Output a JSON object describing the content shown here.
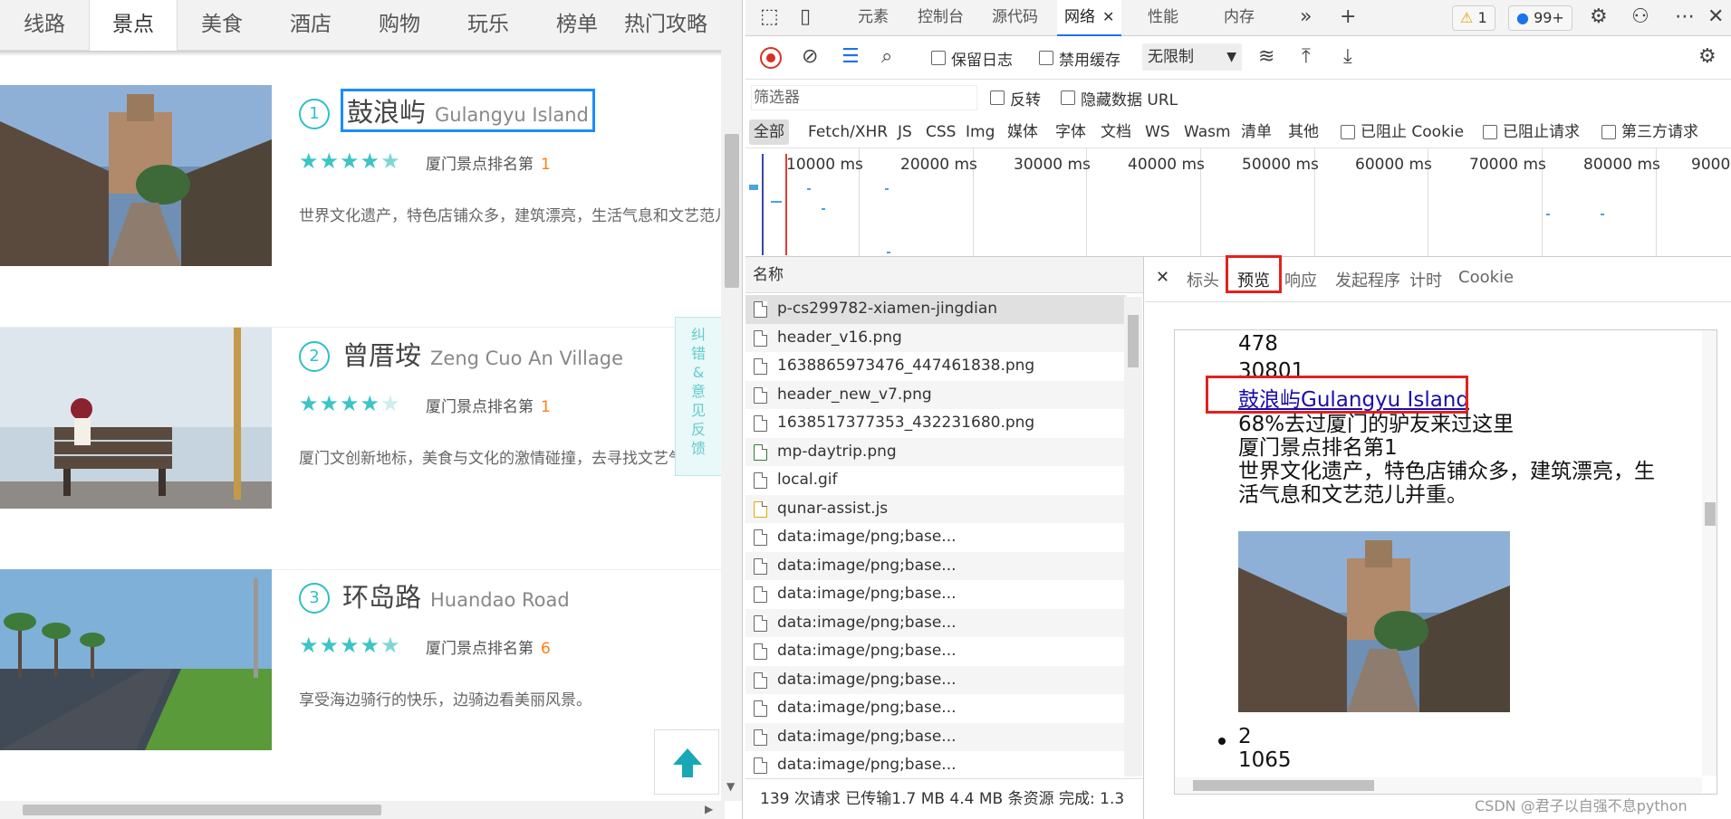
{
  "nav": {
    "items": [
      "线路",
      "景点",
      "美食",
      "酒店",
      "购物",
      "玩乐",
      "榜单",
      "热门攻略"
    ],
    "active_index": 1
  },
  "spots": [
    {
      "rank": "1",
      "name_cn": "鼓浪屿",
      "name_en": "Gulangyu Island",
      "stars": 4.5,
      "rank_text": "厦门景点排名第",
      "rank_num": "1",
      "desc": "世界文化遗产，特色店铺众多，建筑漂亮，生活气息和文艺范儿并重。"
    },
    {
      "rank": "2",
      "name_cn": "曾厝垵",
      "name_en": "Zeng Cuo An Village",
      "stars": 4,
      "rank_text": "厦门景点排名第",
      "rank_num": "1",
      "desc": "厦门文创新地标，美食与文化的激情碰撞，去寻找文艺气息吧。"
    },
    {
      "rank": "3",
      "name_cn": "环岛路",
      "name_en": "Huandao Road",
      "stars": 4.5,
      "rank_text": "厦门景点排名第",
      "rank_num": "6",
      "desc": "享受海边骑行的快乐，边骑边看美丽风景。"
    }
  ],
  "feedback_label": "纠错&意见反馈",
  "devtools": {
    "tabs": [
      "元素",
      "控制台",
      "源代码",
      "网络",
      "性能",
      "内存"
    ],
    "active_tab": "网络",
    "warning_count": "1",
    "message_count": "99+",
    "toolbar": {
      "preserve_log": "保留日志",
      "disable_cache": "禁用缓存",
      "throttle": "无限制"
    },
    "filter": {
      "placeholder": "筛选器",
      "invert": "反转",
      "hide_data_urls": "隐藏数据 URL"
    },
    "types": [
      "全部",
      "Fetch/XHR",
      "JS",
      "CSS",
      "Img",
      "媒体",
      "字体",
      "文档",
      "WS",
      "Wasm",
      "清单",
      "其他"
    ],
    "blocked": {
      "cookies": "已阻止 Cookie",
      "requests": "已阻止请求",
      "third_party": "第三方请求"
    },
    "timeline_ticks": [
      "10000 ms",
      "20000 ms",
      "30000 ms",
      "40000 ms",
      "50000 ms",
      "60000 ms",
      "70000 ms",
      "80000 ms",
      "9000"
    ],
    "name_header": "名称",
    "requests": [
      "p-cs299782-xiamen-jingdian",
      "header_v16.png",
      "1638865973476_447461838.png",
      "header_new_v7.png",
      "1638517377353_432231680.png",
      "mp-daytrip.png",
      "local.gif",
      "qunar-assist.js",
      "data:image/png;base...",
      "data:image/png;base...",
      "data:image/png;base...",
      "data:image/png;base...",
      "data:image/png;base...",
      "data:image/png;base...",
      "data:image/png;base...",
      "data:image/png;base...",
      "data:image/png;base..."
    ],
    "status": "139 次请求  已传输1.7 MB  4.4 MB 条资源  完成: 1.3",
    "detail_tabs": [
      "标头",
      "预览",
      "响应",
      "发起程序",
      "计时",
      "Cookie"
    ],
    "detail_active": "预览",
    "preview": {
      "line1": "478",
      "line2": "30801",
      "link": "鼓浪屿Gulangyu Island",
      "line3": "68%去过厦门的驴友来过这里",
      "line4": "厦门景点排名第1",
      "line5": "世界文化遗产，特色店铺众多，建筑漂亮，生",
      "line6": "活气息和文艺范儿并重。",
      "bullet_num": "2",
      "line7": "1065"
    }
  },
  "watermark": "CSDN @君子以自强不息python",
  "colors": {
    "accent": "#2ec0c3",
    "highlight_box": "#e0221f",
    "select_box": "#1a8cff",
    "rank_num": "#ff7d13"
  }
}
